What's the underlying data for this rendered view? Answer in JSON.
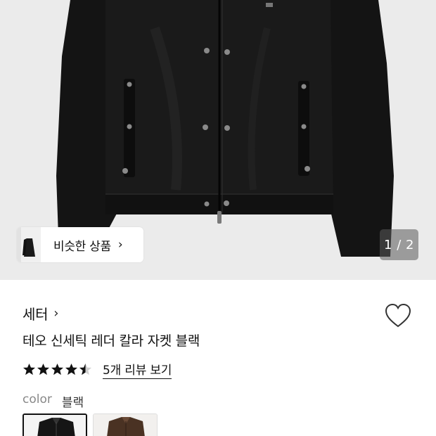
{
  "hero": {
    "image_icon": "black-leather-jacket-photo",
    "similar_products_label": "비슷한 상품",
    "similar_products_chevron": "›",
    "pager_text": "1 / 2"
  },
  "product": {
    "brand": "세터",
    "brand_chevron": "›",
    "title": "테오 신세틱 레더 칼라 자켓 블랙",
    "rating": 4.5,
    "review_link": "5개 리뷰 보기",
    "wishlist_icon": "heart-outline-icon"
  },
  "color": {
    "label": "color",
    "value": "블랙",
    "swatches": [
      "black-jacket-swatch",
      "brown-jacket-swatch"
    ]
  },
  "colors": {
    "background_hero": "#ebebeb",
    "jacket": "#141414",
    "text": "#111111",
    "muted": "#888888"
  }
}
